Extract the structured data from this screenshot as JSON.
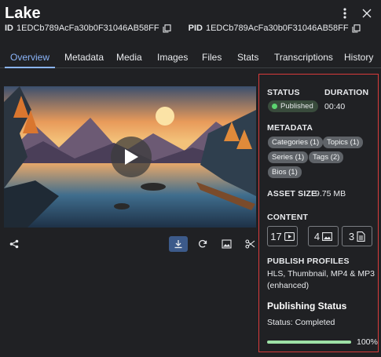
{
  "header": {
    "title": "Lake",
    "id_label": "ID",
    "id_value": "1EDCb789AcFa30b0F31046AB58FF",
    "pid_label": "PID",
    "pid_value": "1EDCb789AcFa30b0F31046AB58FF"
  },
  "tabs": [
    "Overview",
    "Metadata",
    "Media",
    "Images",
    "Files",
    "Stats",
    "Transcriptions",
    "History"
  ],
  "active_tab": "Overview",
  "panel": {
    "status_label": "STATUS",
    "status_value": "Published",
    "duration_label": "DURATION",
    "duration_value": "00:40",
    "metadata_label": "METADATA",
    "metadata_chips": [
      "Categories (1)",
      "Topics (1)",
      "Series (1)",
      "Tags (2)",
      "Bios (1)"
    ],
    "asset_size_label": "ASSET SIZE",
    "asset_size_value": "9.75 MB",
    "content_label": "CONTENT",
    "content_video_count": "17",
    "content_image_count": "4",
    "content_doc_count": "3",
    "publish_profiles_label": "PUBLISH PROFILES",
    "publish_profiles_line1": "HLS, Thumbnail, MP4 & MP3",
    "publish_profiles_line2": "(enhanced)",
    "publishing_status_title": "Publishing Status",
    "publishing_status_text": "Status: Completed",
    "progress_percent_label": "100%",
    "progress_fraction": 1.0
  },
  "colors": {
    "accent": "#8ab4f8",
    "published_dot": "#5cd470",
    "progress": "#9ee2a6",
    "panel_border": "#d93b3b"
  },
  "icons": [
    "more-vert-icon",
    "close-icon",
    "copy-icon",
    "share-icon",
    "download-icon",
    "refresh-icon",
    "image-icon",
    "scissors-icon",
    "play-icon",
    "video-icon",
    "document-icon"
  ]
}
